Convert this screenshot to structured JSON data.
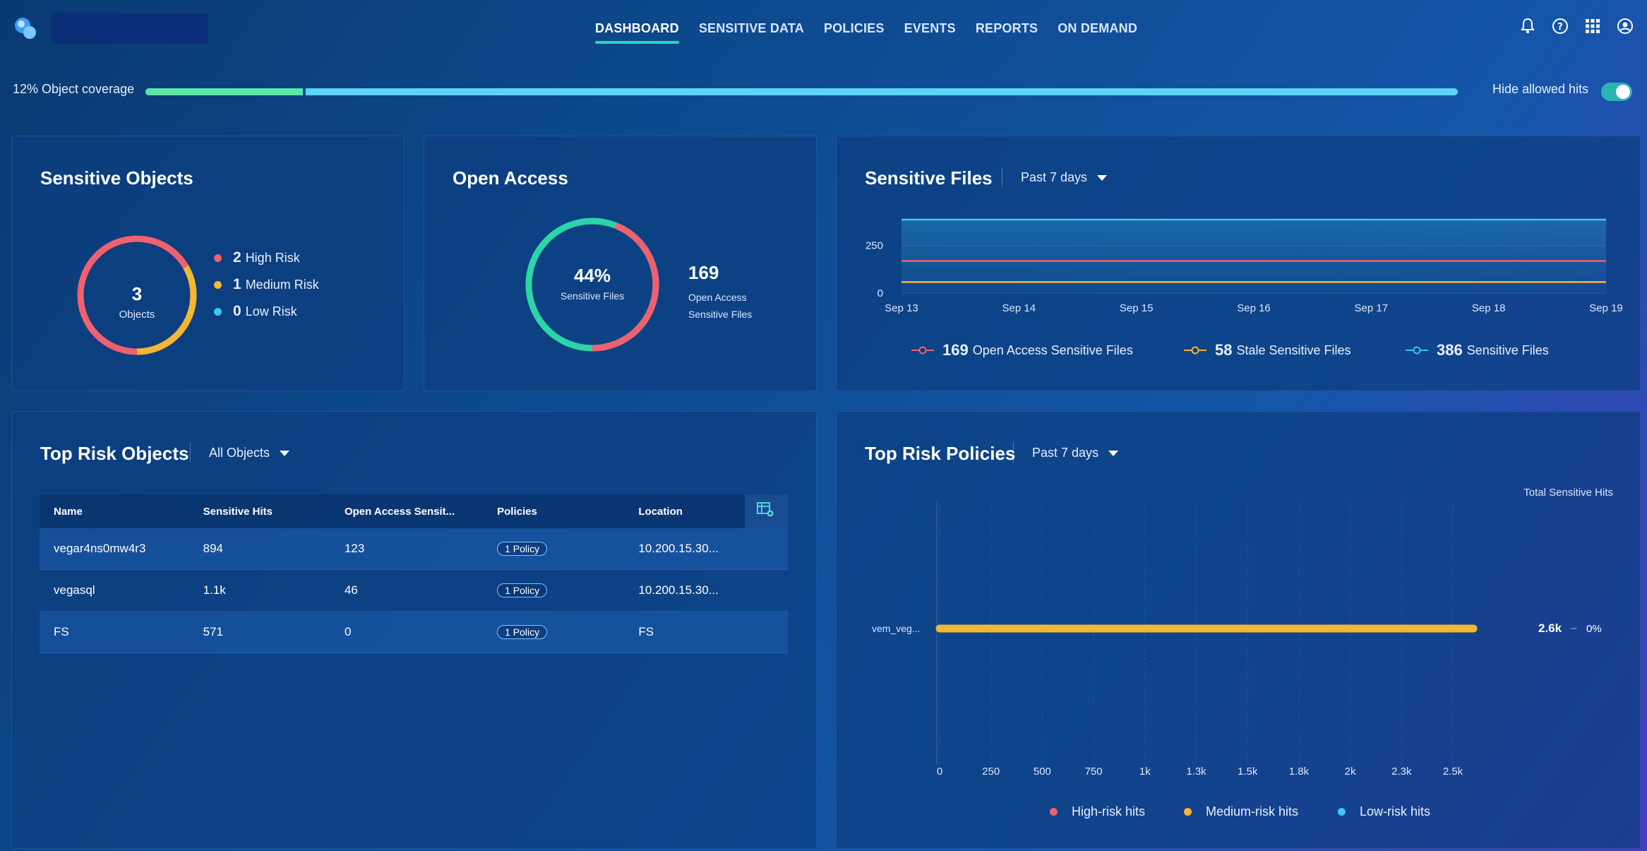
{
  "nav": {
    "items": [
      {
        "label": "DASHBOARD",
        "active": true
      },
      {
        "label": "SENSITIVE DATA",
        "active": false
      },
      {
        "label": "POLICIES",
        "active": false
      },
      {
        "label": "EVENTS",
        "active": false
      },
      {
        "label": "REPORTS",
        "active": false
      },
      {
        "label": "ON DEMAND",
        "active": false
      }
    ],
    "icons": [
      "bell-icon",
      "help-icon",
      "apps-grid-icon",
      "user-account-icon"
    ]
  },
  "coverage": {
    "label": "12% Object coverage",
    "percent": 12
  },
  "hide_allowed": {
    "label": "Hide allowed hits",
    "enabled": true
  },
  "sensitive_objects": {
    "title": "Sensitive Objects",
    "total": "3",
    "total_label": "Objects",
    "legend": [
      {
        "count": "2",
        "label": "High Risk",
        "color": "#f0606e"
      },
      {
        "count": "1",
        "label": "Medium Risk",
        "color": "#f5b731"
      },
      {
        "count": "0",
        "label": "Low Risk",
        "color": "#3cc6f5"
      }
    ]
  },
  "open_access": {
    "title": "Open Access",
    "percent": "44%",
    "percent_label": "Sensitive Files",
    "count": "169",
    "count_label_1": "Open Access",
    "count_label_2": "Sensitive Files",
    "colors": {
      "open": "#f0606e",
      "rest": "#2dd4a8"
    }
  },
  "sensitive_files": {
    "title": "Sensitive Files",
    "filter": "Past 7 days",
    "legend": [
      {
        "count": "169",
        "label": "Open Access Sensitive Files",
        "color": "#f0606e"
      },
      {
        "count": "58",
        "label": "Stale Sensitive Files",
        "color": "#f5b731"
      },
      {
        "count": "386",
        "label": "Sensitive Files",
        "color": "#3cc6f5"
      }
    ]
  },
  "top_risk_objects": {
    "title": "Top Risk Objects",
    "filter": "All Objects",
    "columns": [
      "Name",
      "Sensitive Hits",
      "Open Access Sensit...",
      "Policies",
      "Location"
    ],
    "rows": [
      {
        "name": "vegar4ns0mw4r3",
        "hits": "894",
        "open": "123",
        "policy": "1 Policy",
        "location": "10.200.15.30..."
      },
      {
        "name": "vegasql",
        "hits": "1.1k",
        "open": "46",
        "policy": "1 Policy",
        "location": "10.200.15.30..."
      },
      {
        "name": "FS",
        "hits": "571",
        "open": "0",
        "policy": "1 Policy",
        "location": "FS"
      }
    ]
  },
  "top_risk_policies": {
    "title": "Top Risk Policies",
    "filter": "Past 7 days",
    "total_label": "Total Sensitive Hits",
    "bar_total": "2.6k",
    "bar_pct": "0%",
    "legend": [
      {
        "label": "High-risk hits",
        "color": "#f0606e"
      },
      {
        "label": "Medium-risk hits",
        "color": "#f5b731"
      },
      {
        "label": "Low-risk hits",
        "color": "#3cc6f5"
      }
    ]
  },
  "chart_data": [
    {
      "type": "line",
      "title": "Sensitive Files",
      "x": [
        "Sep 13",
        "Sep 14",
        "Sep 15",
        "Sep 16",
        "Sep 17",
        "Sep 18",
        "Sep 19"
      ],
      "yticks": [
        0,
        250
      ],
      "ylim": [
        0,
        386
      ],
      "series": [
        {
          "name": "Open Access Sensitive Files",
          "values": [
            169,
            169,
            169,
            169,
            169,
            169,
            169
          ],
          "color": "#f0606e"
        },
        {
          "name": "Stale Sensitive Files",
          "values": [
            58,
            58,
            58,
            58,
            58,
            58,
            58
          ],
          "color": "#f5b731"
        },
        {
          "name": "Sensitive Files",
          "values": [
            386,
            386,
            386,
            386,
            386,
            386,
            386
          ],
          "color": "#3cc6f5"
        }
      ]
    },
    {
      "type": "bar",
      "title": "Top Risk Policies",
      "orientation": "horizontal",
      "categories": [
        "vem_veg..."
      ],
      "values": [
        2600
      ],
      "xticks": [
        "0",
        "250",
        "500",
        "750",
        "1k",
        "1.3k",
        "1.5k",
        "1.8k",
        "2k",
        "2.3k",
        "2.5k"
      ],
      "xtick_values": [
        0,
        250,
        500,
        750,
        1000,
        1250,
        1500,
        1750,
        2000,
        2250,
        2500
      ],
      "color": "#f5b731"
    }
  ]
}
